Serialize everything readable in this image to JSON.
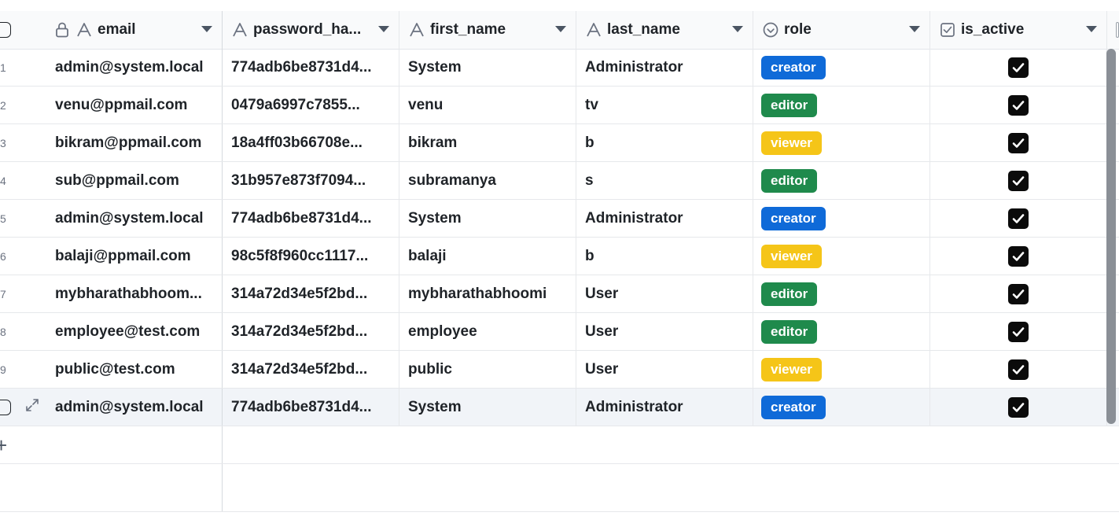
{
  "columns": {
    "email": "email",
    "password_hash": "password_ha...",
    "first_name": "first_name",
    "last_name": "last_name",
    "role": "role",
    "is_active": "is_active"
  },
  "rows": [
    {
      "num": "1",
      "email": "admin@system.local",
      "password_hash": "774adb6be8731d4...",
      "first_name": "System",
      "last_name": "Administrator",
      "role": "creator",
      "is_active": true
    },
    {
      "num": "2",
      "email": "venu@ppmail.com",
      "password_hash": "0479a6997c7855...",
      "first_name": "venu",
      "last_name": "tv",
      "role": "editor",
      "is_active": true
    },
    {
      "num": "3",
      "email": "bikram@ppmail.com",
      "password_hash": "18a4ff03b66708e...",
      "first_name": "bikram",
      "last_name": "b",
      "role": "viewer",
      "is_active": true
    },
    {
      "num": "4",
      "email": "sub@ppmail.com",
      "password_hash": "31b957e873f7094...",
      "first_name": "subramanya",
      "last_name": "s",
      "role": "editor",
      "is_active": true
    },
    {
      "num": "5",
      "email": "admin@system.local",
      "password_hash": "774adb6be8731d4...",
      "first_name": "System",
      "last_name": "Administrator",
      "role": "creator",
      "is_active": true
    },
    {
      "num": "6",
      "email": "balaji@ppmail.com",
      "password_hash": "98c5f8f960cc1117...",
      "first_name": "balaji",
      "last_name": "b",
      "role": "viewer",
      "is_active": true
    },
    {
      "num": "7",
      "email": "mybharathabhoom...",
      "password_hash": "314a72d34e5f2bd...",
      "first_name": "mybharathabhoomi",
      "last_name": "User",
      "role": "editor",
      "is_active": true
    },
    {
      "num": "8",
      "email": "employee@test.com",
      "password_hash": "314a72d34e5f2bd...",
      "first_name": "employee",
      "last_name": "User",
      "role": "editor",
      "is_active": true
    },
    {
      "num": "9",
      "email": "public@test.com",
      "password_hash": "314a72d34e5f2bd...",
      "first_name": "public",
      "last_name": "User",
      "role": "viewer",
      "is_active": true
    },
    {
      "num": "",
      "email": "admin@system.local",
      "password_hash": "774adb6be8731d4...",
      "first_name": "System",
      "last_name": "Administrator",
      "role": "creator",
      "is_active": true,
      "highlight": true
    }
  ],
  "add_row_symbol": "+",
  "colors": {
    "creator": "#0f6ad8",
    "editor": "#1f8a4c",
    "viewer": "#f5c518"
  }
}
